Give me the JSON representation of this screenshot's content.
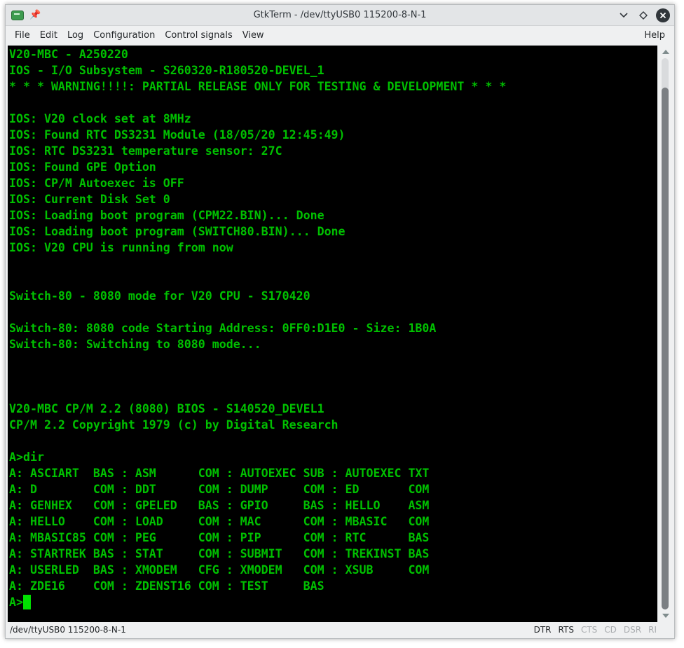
{
  "window": {
    "title": "GtkTerm - /dev/ttyUSB0 115200-8-N-1"
  },
  "icons": {
    "app": "terminal-app-icon",
    "pin": "pin-icon",
    "minimize": "chevron-down-icon",
    "maximize": "diamond-maximize-icon",
    "close": "close-icon"
  },
  "menu": {
    "items": [
      "File",
      "Edit",
      "Log",
      "Configuration",
      "Control signals",
      "View"
    ],
    "help": "Help"
  },
  "terminal": {
    "lines": [
      "V20-MBC - A250220",
      "IOS - I/O Subsystem - S260320-R180520-DEVEL_1",
      "* * * WARNING!!!!: PARTIAL RELEASE ONLY FOR TESTING & DEVELOPMENT * * *",
      "",
      "IOS: V20 clock set at 8MHz",
      "IOS: Found RTC DS3231 Module (18/05/20 12:45:49)",
      "IOS: RTC DS3231 temperature sensor: 27C",
      "IOS: Found GPE Option",
      "IOS: CP/M Autoexec is OFF",
      "IOS: Current Disk Set 0",
      "IOS: Loading boot program (CPM22.BIN)... Done",
      "IOS: Loading boot program (SWITCH80.BIN)... Done",
      "IOS: V20 CPU is running from now",
      "",
      "",
      "Switch-80 - 8080 mode for V20 CPU - S170420",
      "",
      "Switch-80: 8080 code Starting Address: 0FF0:D1E0 - Size: 1B0A",
      "Switch-80: Switching to 8080 mode...",
      "",
      "",
      "",
      "V20-MBC CP/M 2.2 (8080) BIOS - S140520_DEVEL1",
      "CP/M 2.2 Copyright 1979 (c) by Digital Research",
      "",
      "A>dir",
      "A: ASCIART  BAS : ASM      COM : AUTOEXEC SUB : AUTOEXEC TXT",
      "A: D        COM : DDT      COM : DUMP     COM : ED       COM",
      "A: GENHEX   COM : GPELED   BAS : GPIO     BAS : HELLO    ASM",
      "A: HELLO    COM : LOAD     COM : MAC      COM : MBASIC   COM",
      "A: MBASIC85 COM : PEG      COM : PIP      COM : RTC      BAS",
      "A: STARTREK BAS : STAT     COM : SUBMIT   COM : TREKINST BAS",
      "A: USERLED  BAS : XMODEM   CFG : XMODEM   COM : XSUB     COM",
      "A: ZDE16    COM : ZDENST16 COM : TEST     BAS"
    ],
    "prompt": "A>",
    "colors": {
      "background": "#000000",
      "foreground": "#00c000",
      "cursor": "#00e000"
    }
  },
  "status": {
    "port": "/dev/ttyUSB0  115200-8-N-1",
    "signals": [
      {
        "label": "DTR",
        "active": true
      },
      {
        "label": "RTS",
        "active": true
      },
      {
        "label": "CTS",
        "active": false
      },
      {
        "label": "CD",
        "active": false
      },
      {
        "label": "DSR",
        "active": false
      },
      {
        "label": "RI",
        "active": false
      }
    ]
  }
}
